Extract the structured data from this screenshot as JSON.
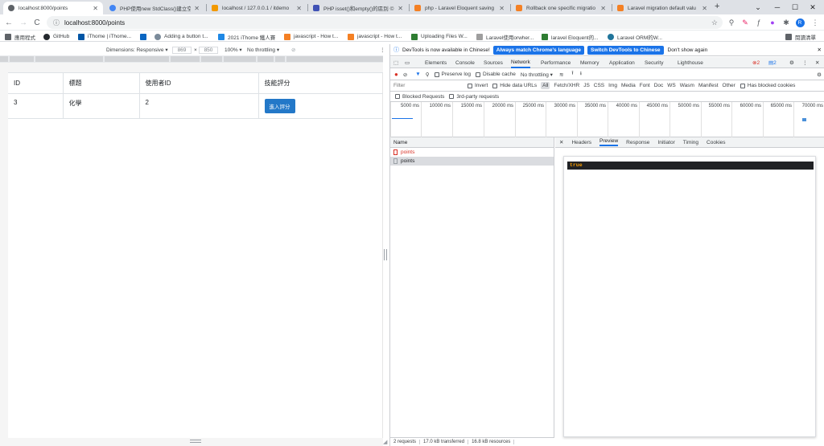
{
  "browser": {
    "tabs": [
      {
        "title": "localhost:8000/points",
        "active": true,
        "color": "#5f6368"
      },
      {
        "title": "PHP使用new StdClass()建立空",
        "active": false,
        "color": "#4285f4"
      },
      {
        "title": "localhost / 127.0.0.1 / itdemo",
        "active": false,
        "color": "#f29900"
      },
      {
        "title": "PHP isset()和empty()的區別 ©",
        "active": false,
        "color": "#3f51b5"
      },
      {
        "title": "php - Laravel Eloquent saving",
        "active": false,
        "color": "#f48024"
      },
      {
        "title": "Rollback one specific migratio",
        "active": false,
        "color": "#f48024"
      },
      {
        "title": "Laravel migration default valu",
        "active": false,
        "color": "#f48024"
      }
    ],
    "new_tab": "+",
    "window_controls": [
      "⌄",
      "─",
      "☐",
      "✕"
    ],
    "url": "localhost:8000/points",
    "bookmarks": [
      {
        "label": "應用程式",
        "color": "#5f6368"
      },
      {
        "label": "GitHub",
        "color": "#24292e"
      },
      {
        "label": "iThome | iThome...",
        "color": "#0055a5"
      },
      {
        "label": "in",
        "color": "#0a66c2"
      },
      {
        "label": "Adding a button t...",
        "color": "#7b8b9a"
      },
      {
        "label": "2021 iThome 鐵人賽",
        "color": "#1e88e5"
      },
      {
        "label": "javascript - How t...",
        "color": "#f48024"
      },
      {
        "label": "javascript - How t...",
        "color": "#f48024"
      },
      {
        "label": "Uploading Files W...",
        "color": "#2e7d32"
      },
      {
        "label": "Laravel使用orwher...",
        "color": "#9e9e9e"
      },
      {
        "label": "laravel Eloquent的...",
        "color": "#2e7d32"
      },
      {
        "label": "Laravel ORM的W...",
        "color": "#21759b"
      }
    ],
    "reading_list": "閱讀清單",
    "profile_letter": "R"
  },
  "device_toolbar": {
    "dimensions_label": "Dimensions: Responsive",
    "width": "869",
    "x_sep": "×",
    "height": "850",
    "zoom": "100%",
    "throttle": "No throttling"
  },
  "page": {
    "columns": [
      "ID",
      "標題",
      "使用者ID",
      "技能評分"
    ],
    "rows": [
      {
        "id": "3",
        "title": "化學",
        "user_id": "2",
        "action": "進入評分"
      }
    ]
  },
  "devtools": {
    "info_text": "DevTools is now available in Chinese!",
    "btn_match": "Always match Chrome's language",
    "btn_switch": "Switch DevTools to Chinese",
    "btn_dismiss": "Don't show again",
    "tabs": [
      "Elements",
      "Console",
      "Sources",
      "Network",
      "Performance",
      "Memory",
      "Application",
      "Security",
      "Lighthouse"
    ],
    "active_tab": "Network",
    "errors": "2",
    "messages": "2",
    "preserve_log": "Preserve log",
    "disable_cache": "Disable cache",
    "throttling": "No throttling",
    "filter_placeholder": "Filter",
    "invert": "Invert",
    "hide_data_urls": "Hide data URLs",
    "filters": [
      "All",
      "Fetch/XHR",
      "JS",
      "CSS",
      "Img",
      "Media",
      "Font",
      "Doc",
      "WS",
      "Wasm",
      "Manifest",
      "Other"
    ],
    "has_blocked_cookies": "Has blocked cookies",
    "blocked_requests": "Blocked Requests",
    "third_party": "3rd-party requests",
    "timeline_ticks": [
      "5000 ms",
      "10000 ms",
      "15000 ms",
      "20000 ms",
      "25000 ms",
      "30000 ms",
      "35000 ms",
      "40000 ms",
      "45000 ms",
      "50000 ms",
      "55000 ms",
      "60000 ms",
      "65000 ms",
      "70000 ms"
    ],
    "name_header": "Name",
    "requests": [
      {
        "name": "points",
        "error": true
      },
      {
        "name": "points",
        "error": false
      }
    ],
    "detail_tabs": [
      "Headers",
      "Preview",
      "Response",
      "Initiator",
      "Timing",
      "Cookies"
    ],
    "active_detail_tab": "Preview",
    "preview_value": "true",
    "status": [
      "2 requests",
      "17.0 kB transferred",
      "16.8 kB resources"
    ]
  }
}
